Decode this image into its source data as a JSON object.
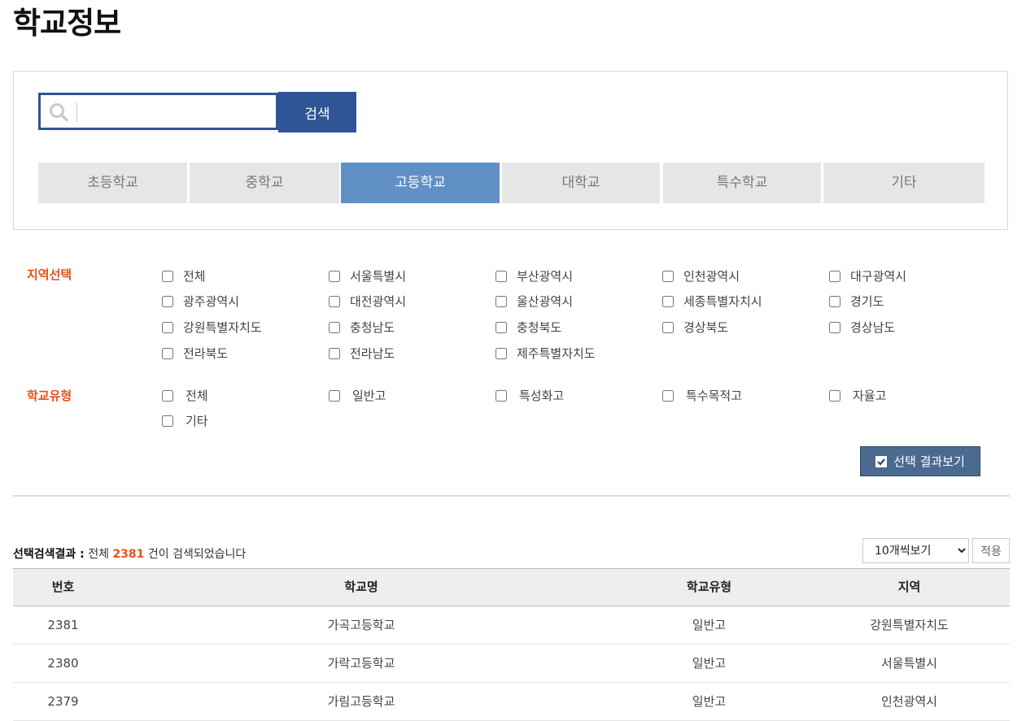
{
  "page": {
    "title": "학교정보"
  },
  "search": {
    "placeholder": "",
    "button_label": "검색"
  },
  "tabs": [
    {
      "label": "초등학교",
      "active": false
    },
    {
      "label": "중학교",
      "active": false
    },
    {
      "label": "고등학교",
      "active": true
    },
    {
      "label": "대학교",
      "active": false
    },
    {
      "label": "특수학교",
      "active": false
    },
    {
      "label": "기타",
      "active": false
    }
  ],
  "region_filter": {
    "label": "지역선택",
    "options": [
      "전체",
      "서울특별시",
      "부산광역시",
      "인천광역시",
      "대구광역시",
      "광주광역시",
      "대전광역시",
      "울산광역시",
      "세종특별자치시",
      "경기도",
      "강원특별자치도",
      "충청남도",
      "충청북도",
      "경상북도",
      "경상남도",
      "전라북도",
      "전라남도",
      "제주특별자치도"
    ]
  },
  "type_filter": {
    "label": "학교유형",
    "options": [
      "전체",
      "일반고",
      "특성화고",
      "특수목적고",
      "자율고",
      "기타"
    ]
  },
  "view_button_label": "선택 결과보기",
  "results": {
    "label": "선택검색결과 :",
    "prefix": "전체",
    "count": "2381",
    "suffix": "건이 검색되었습니다",
    "page_size_options": [
      "10개씩보기"
    ],
    "page_size_selected": "10개씩보기",
    "apply_label": "적용"
  },
  "table": {
    "headers": [
      "번호",
      "학교명",
      "학교유형",
      "지역"
    ],
    "rows": [
      [
        "2381",
        "가곡고등학교",
        "일반고",
        "강원특별자치도"
      ],
      [
        "2380",
        "가락고등학교",
        "일반고",
        "서울특별시"
      ],
      [
        "2379",
        "가림고등학교",
        "일반고",
        "인천광역시"
      ]
    ]
  },
  "colors": {
    "accent": "#2f5597",
    "tab_active": "#6090c4",
    "label": "#e8501c"
  }
}
